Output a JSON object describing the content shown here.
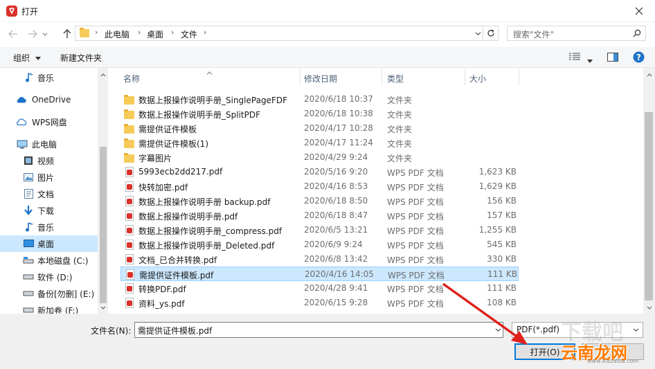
{
  "window": {
    "title": "打开"
  },
  "address": {
    "crumbs": [
      "此电脑",
      "桌面",
      "文件"
    ]
  },
  "search": {
    "placeholder": "搜索\"文件\""
  },
  "toolbar": {
    "organize": "组织",
    "new_folder": "新建文件夹"
  },
  "sidebar": {
    "items": [
      {
        "label": "音乐",
        "icon": "music-note-icon"
      },
      {
        "label": "OneDrive",
        "icon": "cloud-icon"
      },
      {
        "label": "WPS网盘",
        "icon": "wps-cloud-icon"
      },
      {
        "label": "此电脑",
        "icon": "computer-icon"
      },
      {
        "label": "视频",
        "icon": "video-icon"
      },
      {
        "label": "图片",
        "icon": "picture-icon"
      },
      {
        "label": "文档",
        "icon": "document-icon"
      },
      {
        "label": "下载",
        "icon": "download-arrow-icon"
      },
      {
        "label": "音乐",
        "icon": "music-note-icon"
      },
      {
        "label": "桌面",
        "icon": "desktop-icon"
      },
      {
        "label": "本地磁盘 (C:)",
        "icon": "system-drive-icon"
      },
      {
        "label": "软件 (D:)",
        "icon": "drive-icon"
      },
      {
        "label": "备份[勿删] (E:)",
        "icon": "drive-icon"
      },
      {
        "label": "新加卷 (F:)",
        "icon": "drive-icon"
      }
    ]
  },
  "columns": {
    "name": "名称",
    "date": "修改日期",
    "type": "类型",
    "size": "大小"
  },
  "files": [
    {
      "name": "数据上报操作说明手册_SinglePageFDF",
      "date": "2020/6/18 10:37",
      "type": "文件夹",
      "size": "",
      "kind": "folder"
    },
    {
      "name": "数据上报操作说明手册_SplitPDF",
      "date": "2020/6/18 10:38",
      "type": "文件夹",
      "size": "",
      "kind": "folder"
    },
    {
      "name": "需提供证件模板",
      "date": "2020/4/17 10:28",
      "type": "文件夹",
      "size": "",
      "kind": "folder"
    },
    {
      "name": "需提供证件模板(1)",
      "date": "2020/4/17 11:24",
      "type": "文件夹",
      "size": "",
      "kind": "folder"
    },
    {
      "name": "字幕图片",
      "date": "2020/4/29 9:24",
      "type": "文件夹",
      "size": "",
      "kind": "folder"
    },
    {
      "name": "5993ecb2dd217.pdf",
      "date": "2020/5/16 9:20",
      "type": "WPS PDF 文档",
      "size": "1,623 KB",
      "kind": "pdf"
    },
    {
      "name": "快转加密.pdf",
      "date": "2020/4/16 8:53",
      "type": "WPS PDF 文档",
      "size": "1,629 KB",
      "kind": "pdf"
    },
    {
      "name": "数据上报操作说明手册 backup.pdf",
      "date": "2020/6/18 8:50",
      "type": "WPS PDF 文档",
      "size": "156 KB",
      "kind": "pdf"
    },
    {
      "name": "数据上报操作说明手册.pdf",
      "date": "2020/6/18 8:47",
      "type": "WPS PDF 文档",
      "size": "157 KB",
      "kind": "pdf"
    },
    {
      "name": "数据上报操作说明手册_compress.pdf",
      "date": "2020/6/5 13:21",
      "type": "WPS PDF 文档",
      "size": "1,255 KB",
      "kind": "pdf"
    },
    {
      "name": "数据上报操作说明手册_Deleted.pdf",
      "date": "2020/6/9 9:24",
      "type": "WPS PDF 文档",
      "size": "545 KB",
      "kind": "pdf"
    },
    {
      "name": "文档_已合并转换.pdf",
      "date": "2020/6/8 13:42",
      "type": "WPS PDF 文档",
      "size": "330 KB",
      "kind": "pdf"
    },
    {
      "name": "需提供证件模板.pdf",
      "date": "2020/4/16 14:05",
      "type": "WPS PDF 文档",
      "size": "111 KB",
      "kind": "pdf",
      "selected": true
    },
    {
      "name": "转换PDF.pdf",
      "date": "2020/4/28 9:41",
      "type": "WPS PDF 文档",
      "size": "111 KB",
      "kind": "pdf"
    },
    {
      "name": "资料_ys.pdf",
      "date": "2020/6/15 9:28",
      "type": "WPS PDF 文档",
      "size": "108 KB",
      "kind": "pdf"
    }
  ],
  "filename": {
    "label": "文件名(N):",
    "value": "需提供证件模板.pdf"
  },
  "filetype": {
    "value": "PDF(*.pdf)"
  },
  "buttons": {
    "open": "打开(O)"
  },
  "watermark": {
    "main": "云南龙网",
    "sub": "www.xiazaiba.com",
    "ghost": "下载吧"
  },
  "colors": {
    "accent": "#0078d7",
    "selection": "#cce8ff",
    "folder": "#f6cb59",
    "pdf": "#d9312b",
    "arrow": "#e0211b"
  }
}
